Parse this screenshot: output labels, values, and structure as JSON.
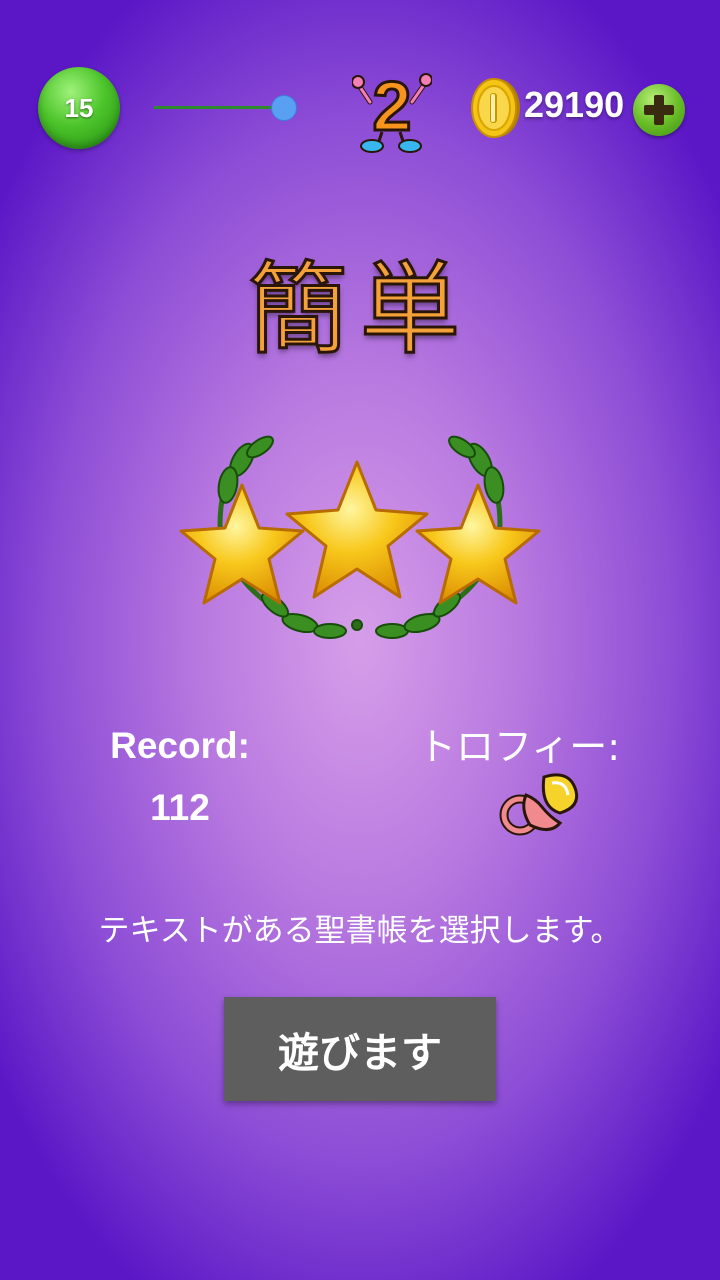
{
  "header": {
    "level": "15",
    "level_progress": 1.0,
    "stage_number": "2",
    "coins": "29190"
  },
  "screen": {
    "difficulty_title": "簡単",
    "stars_earned": 3,
    "stars_total": 3,
    "record_label": "Record:",
    "record_value": "112",
    "trophy_label": "トロフィー:",
    "trophy_icon": "pacifier-icon",
    "instruction": "テキストがある聖書帳を選択します。",
    "play_button": "遊びます"
  },
  "colors": {
    "background_center": "#d69ee9",
    "background_edge": "#5b17c6",
    "title_fill": "#f5a13a",
    "button_bg": "#5e5e5e",
    "level_bubble": "#4cc42a",
    "progress_track": "#2f8a2b",
    "progress_thumb": "#5aa0f2"
  }
}
